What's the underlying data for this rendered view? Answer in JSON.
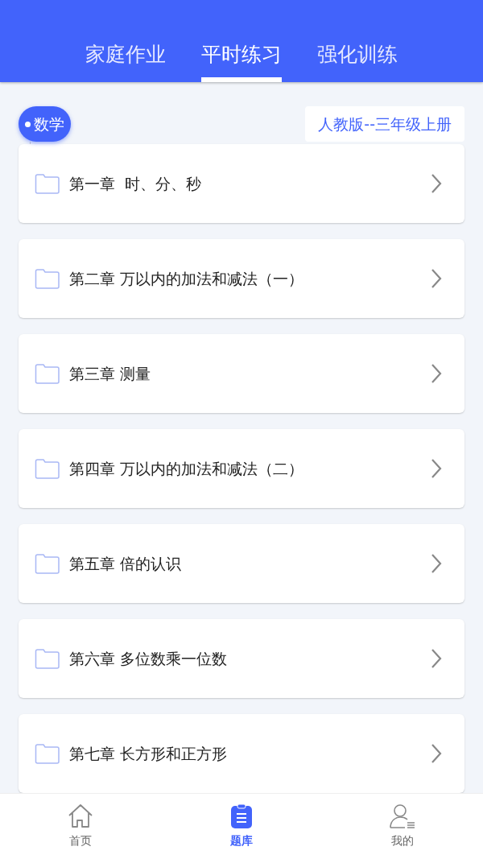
{
  "tabs": [
    {
      "label": "家庭作业",
      "selected": false
    },
    {
      "label": "平时练习",
      "selected": true
    },
    {
      "label": "强化训练",
      "selected": false
    }
  ],
  "subject": "数学",
  "textbook": "人教版--三年级上册",
  "chapters": [
    "第一章  时、分、秒",
    "第二章 万以内的加法和减法（一）",
    "第三章 测量",
    "第四章 万以内的加法和减法（二）",
    "第五章 倍的认识",
    "第六章 多位数乘一位数",
    "第七章 长方形和正方形"
  ],
  "nav": [
    {
      "label": "首页",
      "kind": "home",
      "selected": false
    },
    {
      "label": "题库",
      "kind": "bank",
      "selected": true
    },
    {
      "label": "我的",
      "kind": "profile",
      "selected": false
    }
  ]
}
